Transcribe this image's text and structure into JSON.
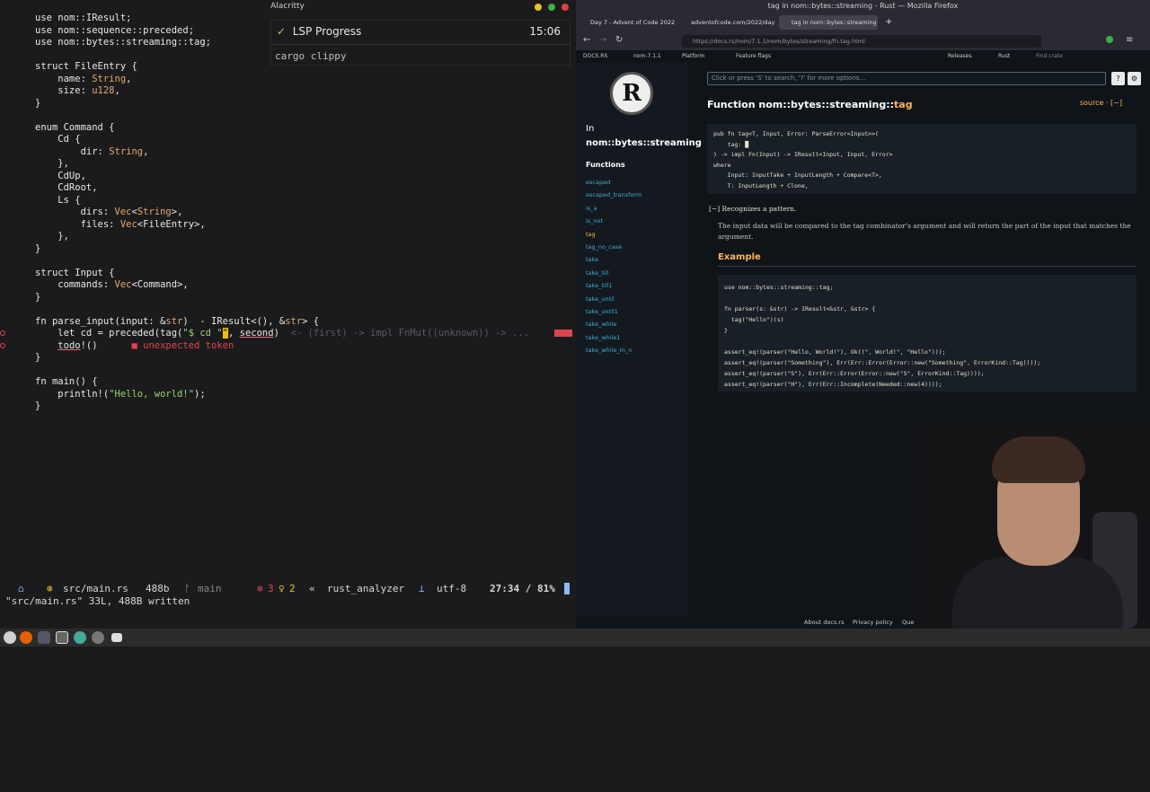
{
  "terminal": {
    "title": "Alacritty",
    "code_lines": [
      {
        "segs": [
          [
            "use ",
            ""
          ],
          [
            "nom",
            "ns"
          ],
          [
            "::IResult;",
            ""
          ]
        ]
      },
      {
        "segs": [
          [
            "use ",
            ""
          ],
          [
            "nom",
            "ns"
          ],
          [
            "::sequence::preceded;",
            ""
          ]
        ]
      },
      {
        "segs": [
          [
            "use ",
            ""
          ],
          [
            "nom",
            "ns"
          ],
          [
            "::bytes::streaming::tag;",
            ""
          ]
        ]
      },
      {
        "segs": [
          [
            "",
            ""
          ]
        ]
      },
      {
        "segs": [
          [
            "struct FileEntry {",
            ""
          ]
        ]
      },
      {
        "segs": [
          [
            "    name: ",
            ""
          ],
          [
            "String",
            "ty"
          ],
          [
            ",",
            ""
          ]
        ]
      },
      {
        "segs": [
          [
            "    size: ",
            ""
          ],
          [
            "u128",
            "ty"
          ],
          [
            ",",
            ""
          ]
        ]
      },
      {
        "segs": [
          [
            "}",
            ""
          ]
        ]
      },
      {
        "segs": [
          [
            "",
            ""
          ]
        ]
      },
      {
        "segs": [
          [
            "enum Command {",
            ""
          ]
        ]
      },
      {
        "segs": [
          [
            "    Cd {",
            ""
          ]
        ]
      },
      {
        "segs": [
          [
            "        dir: ",
            ""
          ],
          [
            "String",
            "ty"
          ],
          [
            ",",
            ""
          ]
        ]
      },
      {
        "segs": [
          [
            "    },",
            ""
          ]
        ]
      },
      {
        "segs": [
          [
            "    CdUp,",
            ""
          ]
        ]
      },
      {
        "segs": [
          [
            "    CdRoot,",
            ""
          ]
        ]
      },
      {
        "segs": [
          [
            "    Ls {",
            ""
          ]
        ]
      },
      {
        "segs": [
          [
            "        dirs: ",
            ""
          ],
          [
            "Vec",
            "ty"
          ],
          [
            "<",
            ""
          ],
          [
            "String",
            "ty"
          ],
          [
            ">,",
            ""
          ]
        ]
      },
      {
        "segs": [
          [
            "        files: ",
            ""
          ],
          [
            "Vec",
            "ty"
          ],
          [
            "<FileEntry>,",
            ""
          ]
        ]
      },
      {
        "segs": [
          [
            "    },",
            ""
          ]
        ]
      },
      {
        "segs": [
          [
            "}",
            ""
          ]
        ]
      },
      {
        "segs": [
          [
            "",
            ""
          ]
        ]
      },
      {
        "segs": [
          [
            "struct Input {",
            ""
          ]
        ]
      },
      {
        "segs": [
          [
            "    commands: ",
            ""
          ],
          [
            "Vec",
            "ty"
          ],
          [
            "<Command>,",
            ""
          ]
        ]
      },
      {
        "segs": [
          [
            "}",
            ""
          ]
        ]
      },
      {
        "segs": [
          [
            "",
            ""
          ]
        ]
      },
      {
        "segs": [
          [
            "fn parse_input(input: &",
            ""
          ],
          [
            "str",
            "ty"
          ],
          [
            ")  -",
            ""
          ],
          [
            " IResult<(), &",
            ""
          ],
          [
            "str",
            "ty"
          ],
          [
            "> {",
            ""
          ]
        ]
      },
      {
        "segs": [
          [
            "    let cd = preceded(tag(",
            ""
          ],
          [
            "\"$ cd \"",
            "st"
          ],
          [
            "\"",
            "err"
          ],
          [
            ", ",
            ""
          ],
          [
            "second",
            "ul"
          ],
          [
            ")",
            ""
          ],
          [
            "  <- (first) -> impl FnMut((unknown)) -> ...",
            "dim"
          ]
        ],
        "err": true
      },
      {
        "segs": [
          [
            "    ",
            ""
          ],
          [
            "todo",
            "ul"
          ],
          [
            "!()      ",
            ""
          ],
          [
            "■ unexpected token",
            "errmsg"
          ]
        ],
        "err": true
      },
      {
        "segs": [
          [
            "}",
            ""
          ]
        ]
      },
      {
        "segs": [
          [
            "",
            ""
          ]
        ]
      },
      {
        "segs": [
          [
            "fn main() {",
            ""
          ]
        ]
      },
      {
        "segs": [
          [
            "    println!(",
            ""
          ],
          [
            "\"Hello, world!\"",
            "st"
          ],
          [
            ");",
            ""
          ]
        ]
      },
      {
        "segs": [
          [
            "}",
            ""
          ]
        ]
      }
    ],
    "popup": {
      "check": "✓",
      "title": "LSP Progress",
      "time": "15:06",
      "body": "cargo clippy"
    },
    "status": {
      "file": "src/main.rs",
      "size": "488b",
      "branch_icon": "ᚠ",
      "branch": "main",
      "errors": "3",
      "warnings": "2",
      "lsp": "rust_analyzer",
      "encoding": "utf-8",
      "position": "27:34 / 81%"
    },
    "cmdline": "\"src/main.rs\" 33L, 488B written"
  },
  "firefox": {
    "title": "tag in nom::bytes::streaming - Rust — Mozilla Firefox",
    "tabs": [
      "Day 7 - Advent of Code 2022",
      "adventofcode.com/2022/day",
      "tag in nom::bytes::streaming"
    ],
    "url": "https://docs.rs/nom/7.1.1/nom/bytes/streaming/fn.tag.html",
    "docsbar": {
      "docsrs": "DOCS.RS",
      "crate": "nom-7.1.1",
      "platform": "Platform",
      "features": "Feature flags",
      "releases": "Releases",
      "rust": "Rust",
      "find": "Find crate"
    },
    "sidebar": {
      "in_label": "In",
      "module": "nom::bytes::streaming",
      "functions_heading": "Functions",
      "functions": [
        "escaped",
        "escaped_transform",
        "is_a",
        "is_not",
        "tag",
        "tag_no_case",
        "take",
        "take_till",
        "take_till1",
        "take_until",
        "take_until1",
        "take_while",
        "take_while1",
        "take_while_m_n"
      ],
      "current": "tag"
    },
    "search_placeholder": "Click or press 'S' to search, '?' for more options...",
    "help_btn": "?",
    "settings_btn": "⚙",
    "title_prefix": "Function nom::bytes::streaming::",
    "title_fn": "tag",
    "source": "source · [−]",
    "signature": [
      "pub fn tag<T, Input, Error: ParseError<Input>>(",
      "    tag: █",
      ") -> impl Fn(Input) -> IResult<Input, Input, Error>",
      "where",
      "    Input: InputTake + InputLength + Compare<T>,",
      "    T: InputLength + Clone,"
    ],
    "summary": "[−] Recognizes a pattern.",
    "description": "The input data will be compared to the tag combinator’s argument and will return the part of the input that matches the argument.",
    "example_heading": "Example",
    "example": [
      "use nom::bytes::streaming::tag;",
      "",
      "fn parser(s: &str) -> IResult<&str, &str> {",
      "  tag(\"Hello\")(s)",
      "}",
      "",
      "assert_eq!(parser(\"Hello, World!\"), Ok((\", World!\", \"Hello\")));",
      "assert_eq!(parser(\"Something\"), Err(Err::Error(Error::new(\"Something\", ErrorKind::Tag))));",
      "assert_eq!(parser(\"S\"), Err(Err::Error(Error::new(\"S\", ErrorKind::Tag))));",
      "assert_eq!(parser(\"H\"), Err(Err::Incomplete(Needed::new(4))));"
    ],
    "footer": {
      "about": "About docs.rs",
      "privacy": "Privacy policy",
      "more": "Que"
    }
  },
  "colors": {
    "accent": "#ffb454",
    "link": "#39afd7",
    "error": "#e0444d"
  }
}
